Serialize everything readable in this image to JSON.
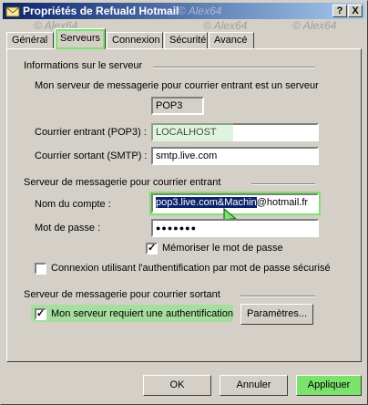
{
  "window": {
    "title": "Propriétés de Refuald Hotmail",
    "help_btn": "?",
    "close_btn": "X",
    "watermark": "© Alex64"
  },
  "tabs": [
    "Général",
    "Serveurs",
    "Connexion",
    "Sécurité",
    "Avancé"
  ],
  "server_info": {
    "group_title": "Informations sur le serveur",
    "incoming_type_label": "Mon serveur de messagerie pour courrier entrant est un serveur",
    "incoming_type_value": "POP3",
    "incoming_label": "Courrier entrant (POP3) :",
    "incoming_value": "LOCALHOST",
    "outgoing_label": "Courrier sortant (SMTP) :",
    "outgoing_value": "smtp.live.com"
  },
  "incoming_server": {
    "group_title": "Serveur de messagerie pour courrier entrant",
    "account_label": "Nom du compte :",
    "account_selected": "pop3.live.com&Machin",
    "account_rest": "@hotmail.fr",
    "password_label": "Mot de passe :",
    "password_value": "●●●●●●●",
    "remember_label": "Mémoriser le mot de passe",
    "remember_checked": "✓",
    "spa_label": "Connexion utilisant l'authentification par mot de passe sécurisé"
  },
  "outgoing_server": {
    "group_title": "Serveur de messagerie pour courrier sortant",
    "auth_label": "Mon serveur requiert une authentification",
    "auth_checked": "✓",
    "params_btn": "Paramètres..."
  },
  "buttons": {
    "ok": "OK",
    "cancel": "Annuler",
    "apply": "Appliquer"
  }
}
